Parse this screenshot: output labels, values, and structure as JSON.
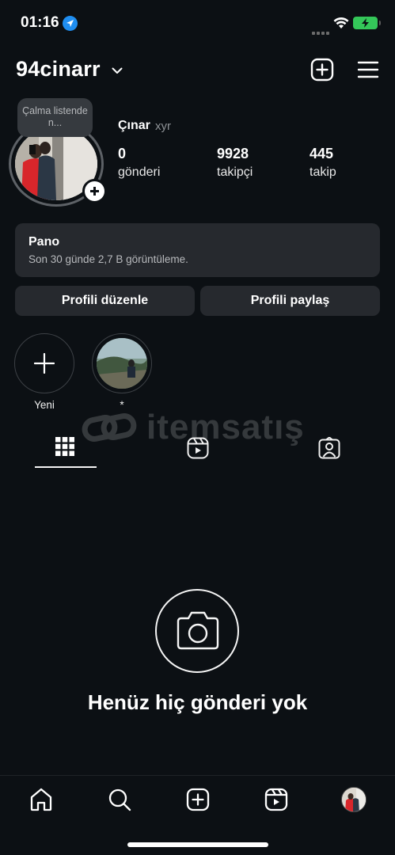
{
  "status_bar": {
    "time": "01:16",
    "icons": [
      "location-icon",
      "signal-dots-icon",
      "wifi-icon",
      "battery-charging-icon"
    ],
    "battery_color": "#34c759"
  },
  "header": {
    "username": "94cinarr",
    "icons": [
      "chevron-down-icon",
      "add-post-icon",
      "menu-icon"
    ]
  },
  "profile": {
    "note": "Çalma listende n...",
    "full_name": "Çınar",
    "pronouns": "xyr",
    "stats": [
      {
        "value": "0",
        "label": "gönderi"
      },
      {
        "value": "9928",
        "label": "takipçi"
      },
      {
        "value": "445",
        "label": "takip"
      }
    ]
  },
  "dashboard": {
    "title": "Pano",
    "subtitle": "Son 30 günde 2,7 B görüntüleme."
  },
  "actions": {
    "edit_profile": "Profili düzenle",
    "share_profile": "Profili paylaş"
  },
  "highlights": [
    {
      "label": "Yeni",
      "icon": "plus-icon"
    },
    {
      "label": "*"
    }
  ],
  "watermark": {
    "text": "itemsatış"
  },
  "tabs": [
    {
      "icon": "grid-icon",
      "active": true
    },
    {
      "icon": "reels-icon",
      "active": false
    },
    {
      "icon": "tagged-icon",
      "active": false
    }
  ],
  "empty_state": {
    "icon": "camera-icon",
    "text": "Henüz hiç gönderi yok"
  },
  "bottom_nav": {
    "items": [
      "home-icon",
      "search-icon",
      "create-icon",
      "reels-icon",
      "profile-avatar"
    ]
  },
  "colors": {
    "background": "#0c1014",
    "card": "#26292e",
    "accent_blue": "#1f8ef1"
  }
}
